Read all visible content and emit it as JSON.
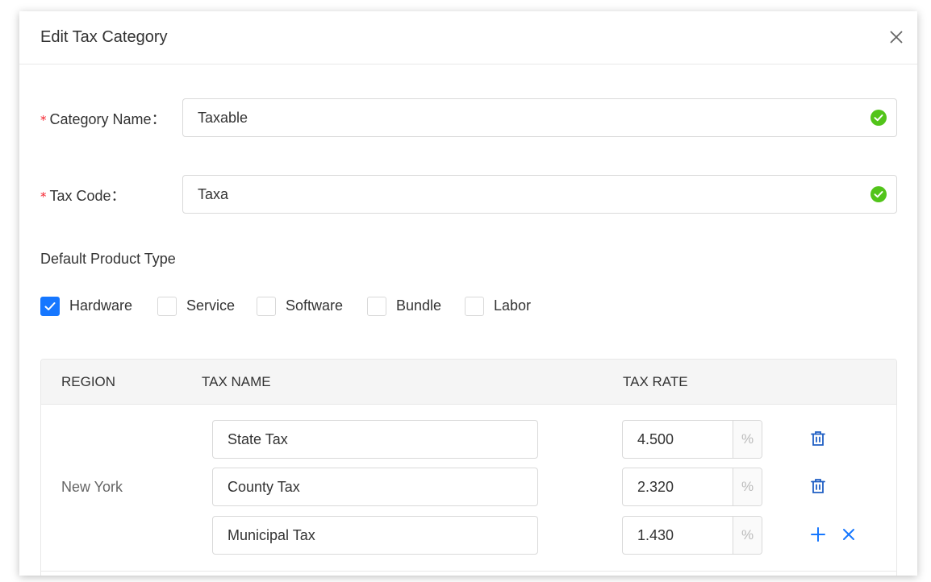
{
  "modal": {
    "title": "Edit Tax Category"
  },
  "form": {
    "category_name": {
      "label": "Category Name",
      "value": "Taxable"
    },
    "tax_code": {
      "label": "Tax Code",
      "value": "Taxa"
    },
    "required_mark": "*",
    "label_suffix": "："
  },
  "product_type": {
    "label": "Default Product Type",
    "options": [
      {
        "label": "Hardware",
        "checked": true
      },
      {
        "label": "Service",
        "checked": false
      },
      {
        "label": "Software",
        "checked": false
      },
      {
        "label": "Bundle",
        "checked": false
      },
      {
        "label": "Labor",
        "checked": false
      }
    ]
  },
  "table": {
    "headers": {
      "region": "REGION",
      "tax_name": "TAX NAME",
      "tax_rate": "TAX RATE"
    },
    "region": "New York",
    "rate_suffix": "%",
    "rows": [
      {
        "name": "State Tax",
        "rate": "4.500",
        "actions": [
          "delete-icon"
        ]
      },
      {
        "name": "County Tax",
        "rate": "2.320",
        "actions": [
          "delete-icon"
        ]
      },
      {
        "name": "Municipal Tax",
        "rate": "1.430",
        "actions": [
          "plus-icon",
          "close-icon"
        ]
      }
    ]
  },
  "colors": {
    "primary": "#1677ff",
    "success": "#52c41a",
    "required": "#f5222d"
  }
}
